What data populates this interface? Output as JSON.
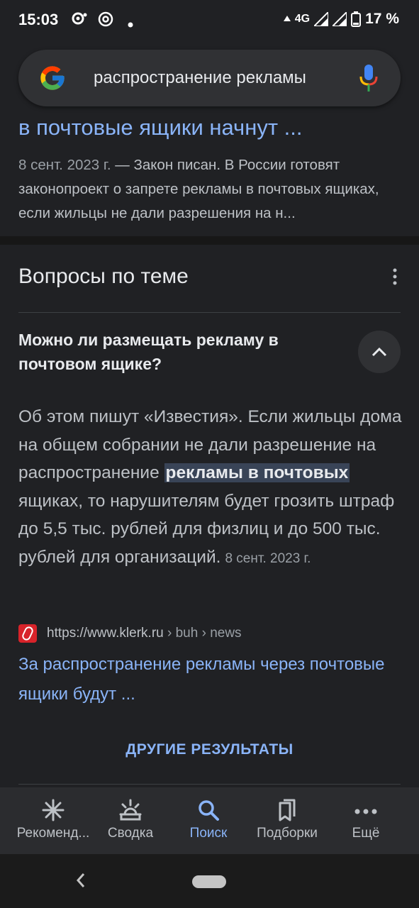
{
  "status_bar": {
    "time": "15:03",
    "network": "4G",
    "battery": "17 %",
    "icons": [
      "assistant-notification-icon",
      "at-sign-icon",
      "dot-icon",
      "wifi-arrow-icon",
      "signal-icon",
      "battery-icon"
    ]
  },
  "search": {
    "query": "распространение рекламы"
  },
  "result": {
    "title": "в почтовые ящики начнут ...",
    "date": "8 сент. 2023 г.",
    "snippet": " — Закон писан. В России готовят законопроект о запрете рекламы в почтовых ящиках, если жильцы не дали разрешения на н..."
  },
  "questions": {
    "heading": "Вопросы по теме",
    "question": "Можно ли размещать рекламу в почтовом ящике?",
    "answer_before": "Об этом пишут «Известия». Если жильцы дома на общем собрании не дали разрешение на распространение ",
    "answer_highlight": "рекламы в почтовых",
    "answer_after": " ящиках, то нарушителям будет грозить штраф до 5,5 тыс. рублей для физлиц и до 500 тыс. рублей для организаций.",
    "answer_date": "8 сент. 2023 г.",
    "source_url": "https://www.klerk.ru",
    "source_crumbs": " › buh › news",
    "source_title": "За распространение рекламы через почтовые ящики будут ...",
    "more_results": "ДРУГИЕ РЕЗУЛЬТАТЫ"
  },
  "bottom_nav": {
    "items": [
      {
        "label": "Рекоменд...",
        "icon": "asterisk-icon"
      },
      {
        "label": "Сводка",
        "icon": "sunrise-icon"
      },
      {
        "label": "Поиск",
        "icon": "search-icon"
      },
      {
        "label": "Подборки",
        "icon": "bookmarks-icon"
      },
      {
        "label": "Ещё",
        "icon": "more-horizontal-icon"
      }
    ],
    "active": "Поиск"
  },
  "colors": {
    "background": "#202124",
    "link": "#8ab4f8",
    "highlight": "#394457"
  }
}
